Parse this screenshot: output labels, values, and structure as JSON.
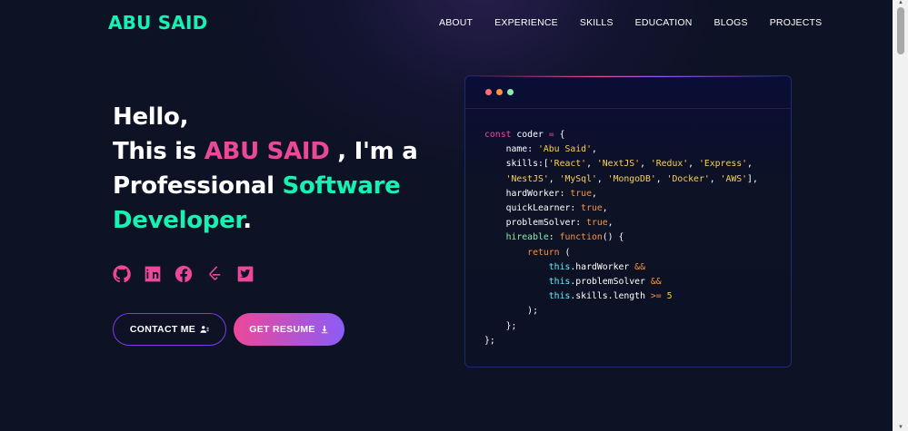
{
  "brand": {
    "logo": "ABU SAID"
  },
  "nav": {
    "items": [
      "ABOUT",
      "EXPERIENCE",
      "SKILLS",
      "EDUCATION",
      "BLOGS",
      "PROJECTS"
    ]
  },
  "hero": {
    "line1": "Hello,",
    "line2_prefix": "This is ",
    "name": "ABU SAID",
    "line2_suffix": " , I'm a",
    "line3_prefix": "Professional ",
    "role_part1": "Software",
    "role_part2": "Developer",
    "period": "."
  },
  "socials": [
    {
      "icon": "github-icon"
    },
    {
      "icon": "linkedin-icon"
    },
    {
      "icon": "facebook-icon"
    },
    {
      "icon": "leetcode-icon"
    },
    {
      "icon": "twitter-icon"
    }
  ],
  "buttons": {
    "contact": "CONTACT ME",
    "resume": "GET RESUME"
  },
  "code": {
    "lines": [
      [
        [
          "k",
          "const "
        ],
        [
          "v",
          "coder "
        ],
        [
          "k",
          "= "
        ],
        [
          "o",
          "{"
        ]
      ],
      [
        [
          "v",
          "    name"
        ],
        [
          "o",
          ": "
        ],
        [
          "s",
          "'Abu Said'"
        ],
        [
          "o",
          ","
        ]
      ],
      [
        [
          "v",
          "    skills"
        ],
        [
          "o",
          ":["
        ],
        [
          "s",
          "'React'"
        ],
        [
          "o",
          ", "
        ],
        [
          "s",
          "'NextJS'"
        ],
        [
          "o",
          ", "
        ],
        [
          "s",
          "'Redux'"
        ],
        [
          "o",
          ", "
        ],
        [
          "s",
          "'Express'"
        ],
        [
          "o",
          ","
        ]
      ],
      [
        [
          "s",
          "    'NestJS'"
        ],
        [
          "o",
          ", "
        ],
        [
          "s",
          "'MySql'"
        ],
        [
          "o",
          ", "
        ],
        [
          "s",
          "'MongoDB'"
        ],
        [
          "o",
          ", "
        ],
        [
          "s",
          "'Docker'"
        ],
        [
          "o",
          ", "
        ],
        [
          "s",
          "'AWS'"
        ],
        [
          "o",
          "],"
        ]
      ],
      [
        [
          "v",
          "    hardWorker"
        ],
        [
          "o",
          ": "
        ],
        [
          "t",
          "true"
        ],
        [
          "o",
          ","
        ]
      ],
      [
        [
          "v",
          "    quickLearner"
        ],
        [
          "o",
          ": "
        ],
        [
          "t",
          "true"
        ],
        [
          "o",
          ","
        ]
      ],
      [
        [
          "v",
          "    problemSolver"
        ],
        [
          "o",
          ": "
        ],
        [
          "t",
          "true"
        ],
        [
          "o",
          ","
        ]
      ],
      [
        [
          "fn",
          "    hireable"
        ],
        [
          "o",
          ": "
        ],
        [
          "t",
          "function"
        ],
        [
          "o",
          "() {"
        ]
      ],
      [
        [
          "t",
          "        return "
        ],
        [
          "o",
          "("
        ]
      ],
      [
        [
          "th",
          "            this"
        ],
        [
          "o",
          "."
        ],
        [
          "v",
          "hardWorker "
        ],
        [
          "t",
          "&&"
        ]
      ],
      [
        [
          "th",
          "            this"
        ],
        [
          "o",
          "."
        ],
        [
          "v",
          "problemSolver "
        ],
        [
          "t",
          "&&"
        ]
      ],
      [
        [
          "th",
          "            this"
        ],
        [
          "o",
          "."
        ],
        [
          "v",
          "skills"
        ],
        [
          "o",
          "."
        ],
        [
          "v",
          "length "
        ],
        [
          "t",
          ">= "
        ],
        [
          "s",
          "5"
        ]
      ],
      [
        [
          "o",
          "        );"
        ]
      ],
      [
        [
          "o",
          "    };"
        ]
      ],
      [
        [
          "o",
          "};"
        ]
      ]
    ]
  },
  "colors": {
    "accent_green": "#16f2b3",
    "accent_pink": "#ec4899",
    "accent_purple": "#8b5cf6",
    "background": "#0d1224"
  }
}
